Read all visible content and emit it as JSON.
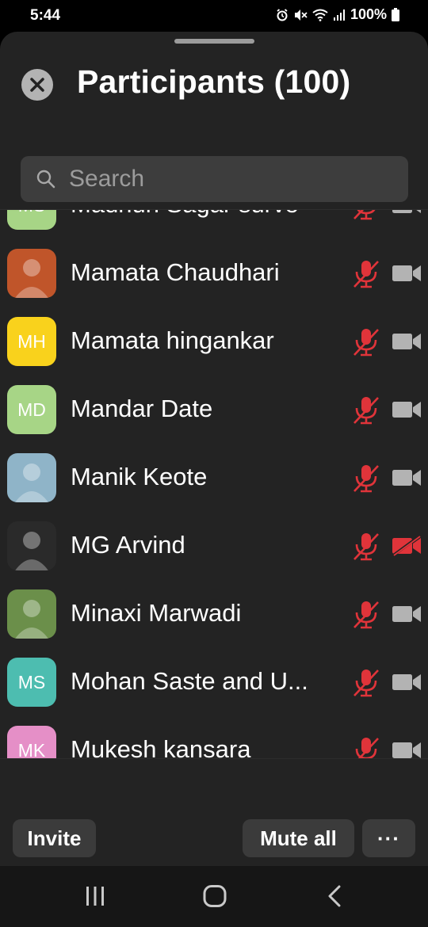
{
  "status_bar": {
    "time": "5:44",
    "battery": "100%",
    "icons": [
      "alarm-icon",
      "mute-icon",
      "wifi-icon",
      "signal-icon",
      "battery-icon"
    ]
  },
  "header": {
    "title": "Participants (100)",
    "close_icon": "close-icon"
  },
  "search": {
    "placeholder": "Search",
    "value": "",
    "icon": "search-icon"
  },
  "colors": {
    "sheet_bg": "#232323",
    "muted_red": "#e0343a",
    "icon_gray": "#b3b3b3",
    "avatar_green": "#a7d586",
    "avatar_yellow": "#f9d21c",
    "avatar_teal": "#4dbdb0",
    "avatar_pink": "#e58fc7"
  },
  "participants": [
    {
      "name": "Madhuri Sagar surve",
      "initials": "MS",
      "avatar_type": "initials",
      "avatar_color": "#a7d586",
      "mic": "muted",
      "video": "off-gray"
    },
    {
      "name": "Mamata Chaudhari",
      "initials": "",
      "avatar_type": "photo",
      "avatar_color": "#c0552a",
      "mic": "muted",
      "video": "off-gray"
    },
    {
      "name": "Mamata hingankar",
      "initials": "MH",
      "avatar_type": "initials",
      "avatar_color": "#f9d21c",
      "mic": "muted",
      "video": "off-gray"
    },
    {
      "name": "Mandar Date",
      "initials": "MD",
      "avatar_type": "initials",
      "avatar_color": "#a7d586",
      "mic": "muted",
      "video": "off-gray"
    },
    {
      "name": "Manik Keote",
      "initials": "",
      "avatar_type": "photo",
      "avatar_color": "#8fb4c8",
      "mic": "muted",
      "video": "off-gray"
    },
    {
      "name": "MG Arvind",
      "initials": "",
      "avatar_type": "photo",
      "avatar_color": "#2a2a2a",
      "mic": "muted",
      "video": "off-red"
    },
    {
      "name": "Minaxi Marwadi",
      "initials": "",
      "avatar_type": "photo",
      "avatar_color": "#6b8f4a",
      "mic": "muted",
      "video": "off-gray"
    },
    {
      "name": "Mohan Saste and U...",
      "initials": "MS",
      "avatar_type": "initials",
      "avatar_color": "#4dbdb0",
      "mic": "muted",
      "video": "off-gray"
    },
    {
      "name": "Mukesh kansara",
      "initials": "MK",
      "avatar_type": "initials",
      "avatar_color": "#e58fc7",
      "mic": "muted",
      "video": "off-gray"
    }
  ],
  "footer": {
    "invite_label": "Invite",
    "mute_all_label": "Mute all",
    "more_label": "···"
  },
  "navbar": {
    "items": [
      "recent-apps-icon",
      "home-icon",
      "back-icon"
    ]
  }
}
